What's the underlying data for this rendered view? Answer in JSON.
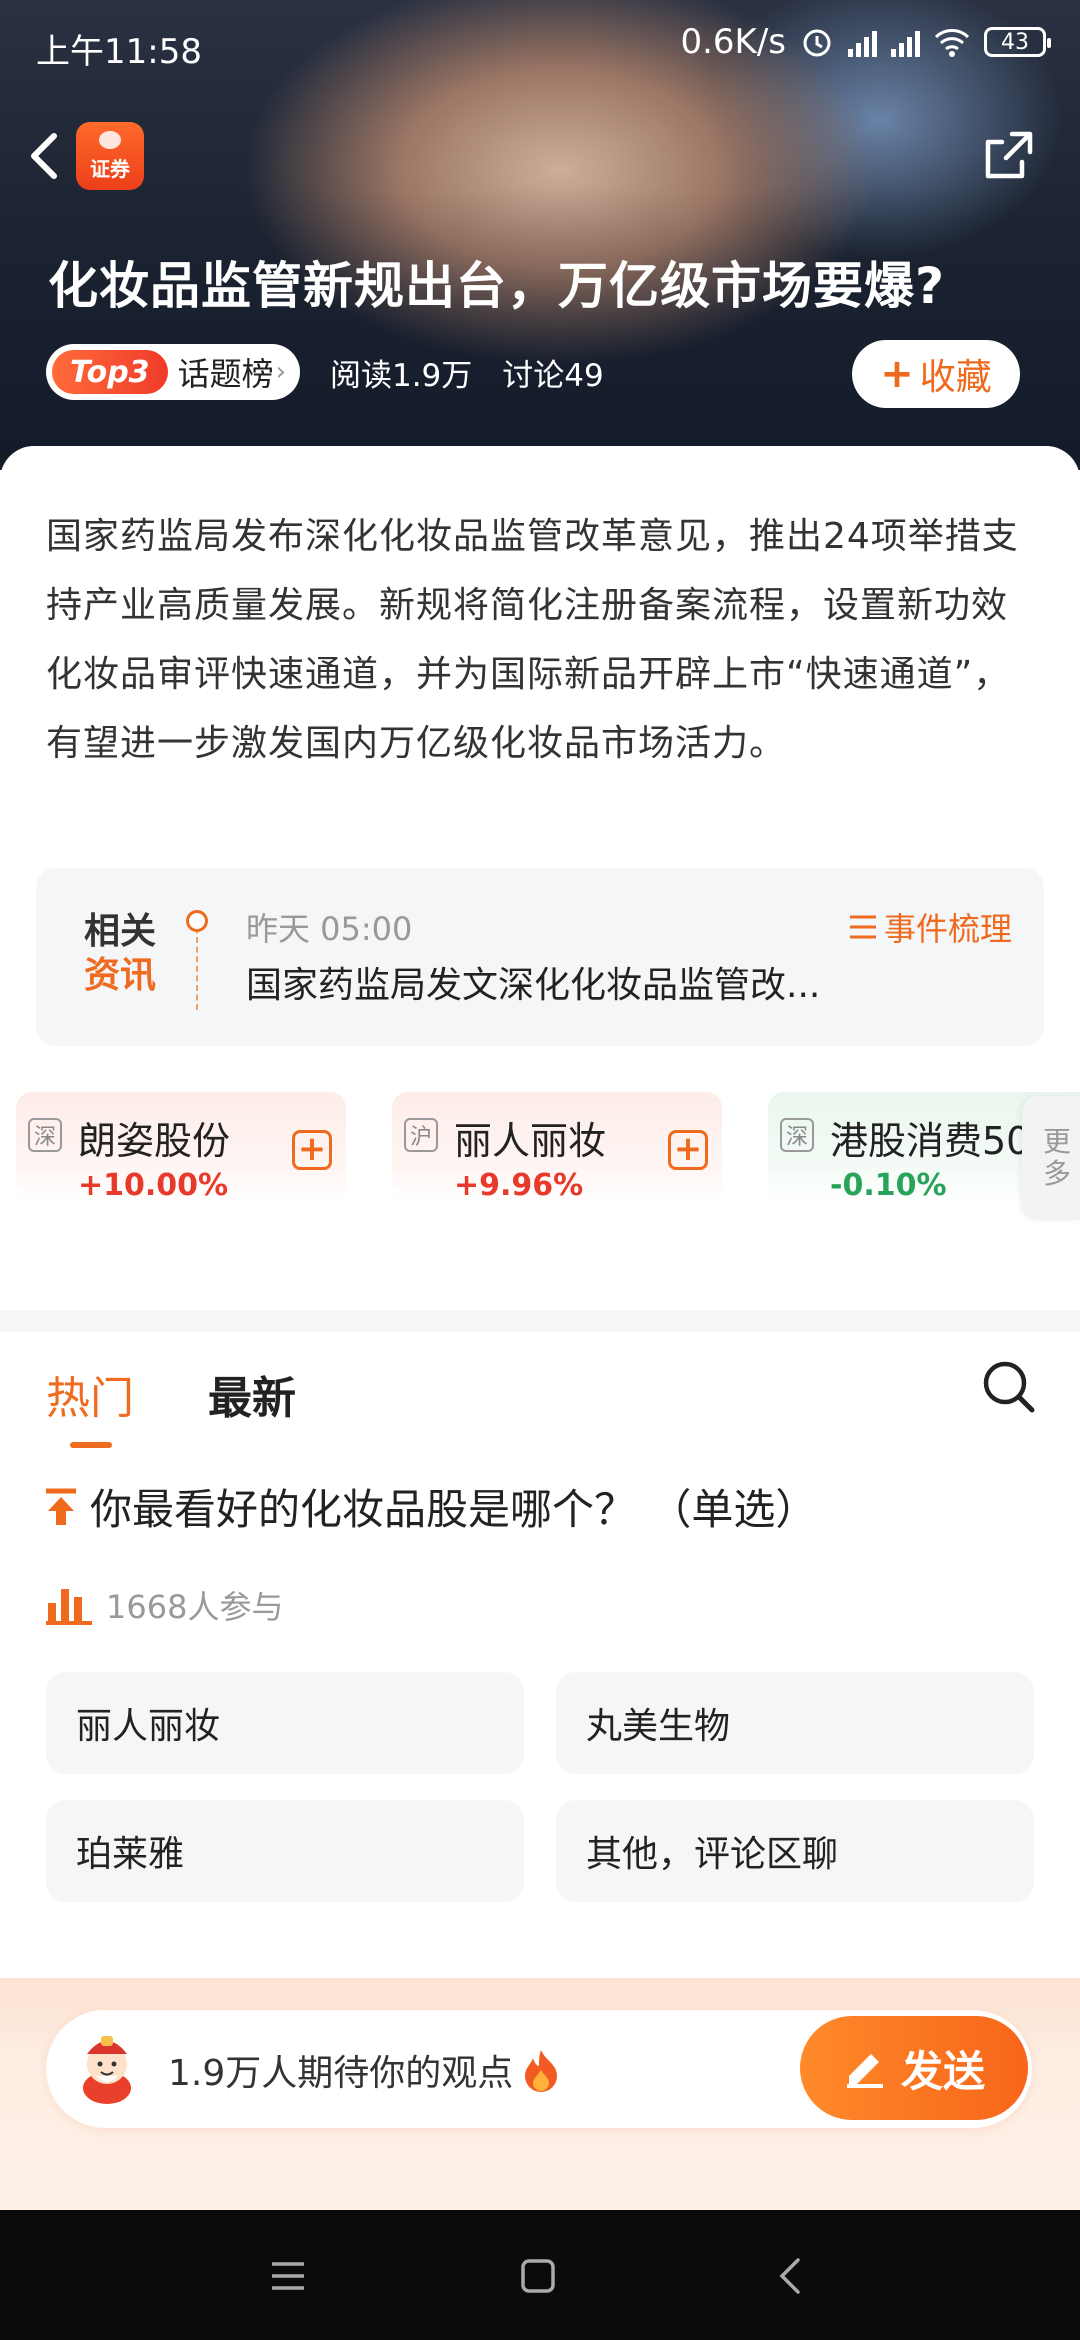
{
  "status_bar": {
    "time": "上午11:58",
    "net_speed": "0.6K/s",
    "battery": "43"
  },
  "topbar": {
    "logo_text": "证券"
  },
  "topic": {
    "title": "化妆品监管新规出台，万亿级市场要爆?",
    "rank_badge": "Top3",
    "rank_label": "话题榜",
    "reads": "阅读1.9万",
    "discussions": "讨论49",
    "favorite_label": "收藏",
    "description": "国家药监局发布深化化妆品监管改革意见，推出24项举措支持产业高质量发展。新规将简化注册备案流程，设置新功效化妆品审评快速通道，并为国际新品开辟上市“快速通道”，有望进一步激发国内万亿级化妆品市场活力。"
  },
  "related_news": {
    "tag_line1": "相关",
    "tag_line2": "资讯",
    "time": "昨天 05:00",
    "title": "国家药监局发文深化化妆品监管改...",
    "timeline_label": "事件梳理"
  },
  "stocks": [
    {
      "market": "深",
      "name": "朗姿股份",
      "change": "+10.00%",
      "direction": "up"
    },
    {
      "market": "沪",
      "name": "丽人丽妆",
      "change": "+9.96%",
      "direction": "up"
    },
    {
      "market": "深",
      "name": "港股消费50",
      "change": "-0.10%",
      "direction": "down"
    }
  ],
  "more_label": "更多",
  "tabs": {
    "hot": "热门",
    "latest": "最新"
  },
  "poll": {
    "question": "你最看好的化妆品股是哪个？ （单选）",
    "participants": "1668人参与",
    "options": [
      "丽人丽妆",
      "丸美生物",
      "珀莱雅",
      "其他，评论区聊"
    ]
  },
  "comment_bar": {
    "placeholder": "1.9万人期待你的观点",
    "send_label": "发送"
  },
  "colors": {
    "accent": "#ef6b1f",
    "up": "#e83a2b",
    "down": "#27a35a"
  }
}
